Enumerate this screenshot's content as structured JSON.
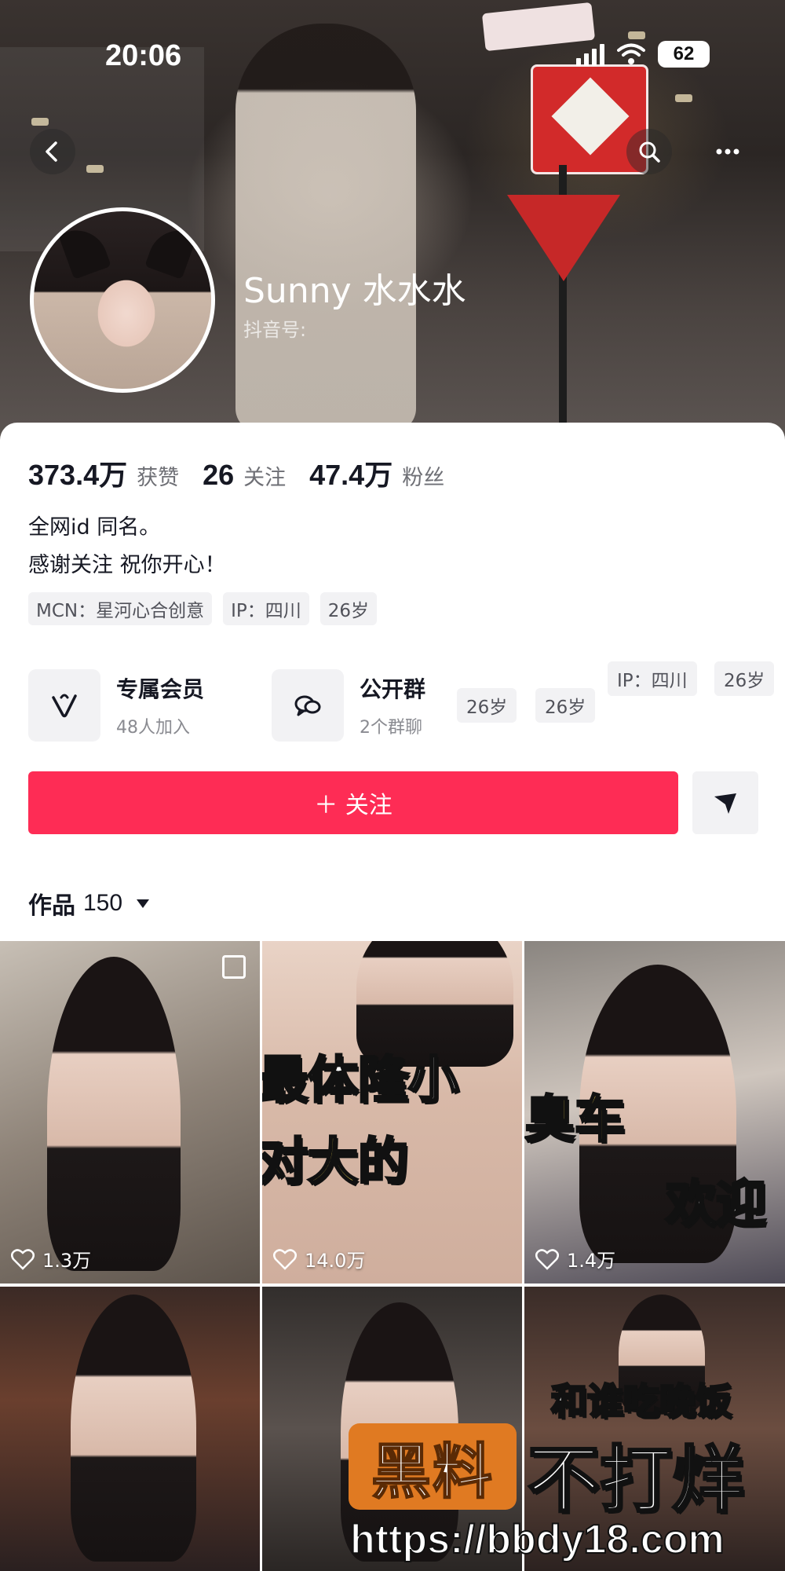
{
  "status_bar": {
    "time": "20:06",
    "battery": "62"
  },
  "profile": {
    "nickname": "Sunny 水水水",
    "douyin_id_label": "抖音号:",
    "stats": [
      {
        "value": "373.4万",
        "label": "获赞"
      },
      {
        "value": "26",
        "label": "关注"
      },
      {
        "value": "47.4万",
        "label": "粉丝"
      }
    ],
    "bio_lines": [
      "全网id 同名。",
      "感谢关注 祝你开心！"
    ],
    "tags": [
      "MCN：星河心合创意",
      "IP：四川",
      "26岁"
    ],
    "features": [
      {
        "icon": "vip-heart-icon",
        "title": "专属会员",
        "subtitle": "48人加入"
      },
      {
        "icon": "group-chat-icon",
        "title": "公开群",
        "subtitle": "2个群聊"
      }
    ],
    "extra_tags": [
      "26岁",
      "26岁",
      "IP：四川",
      "26岁"
    ],
    "follow_label": "＋ 关注",
    "works_label": "作品",
    "works_count": "150"
  },
  "grid": {
    "items": [
      {
        "likes": "1.3万",
        "overlay": ""
      },
      {
        "likes": "14.0万",
        "overlay_lines": [
          "最体隆小",
          "对大的"
        ]
      },
      {
        "likes": "1.4万",
        "overlay_lines": [
          "臭车",
          "欢迎"
        ]
      },
      {
        "likes": "",
        "overlay": ""
      },
      {
        "likes": "",
        "overlay": ""
      },
      {
        "likes": "",
        "overlay_lines": [
          "和谁吃晚饭"
        ]
      }
    ]
  },
  "watermark": {
    "box_text": "黑料",
    "text": "不打烊",
    "url": "https://bbdy18.com"
  },
  "colors": {
    "accent": "#fe2c55",
    "text_primary": "#161823",
    "text_secondary": "#6e6f75"
  }
}
